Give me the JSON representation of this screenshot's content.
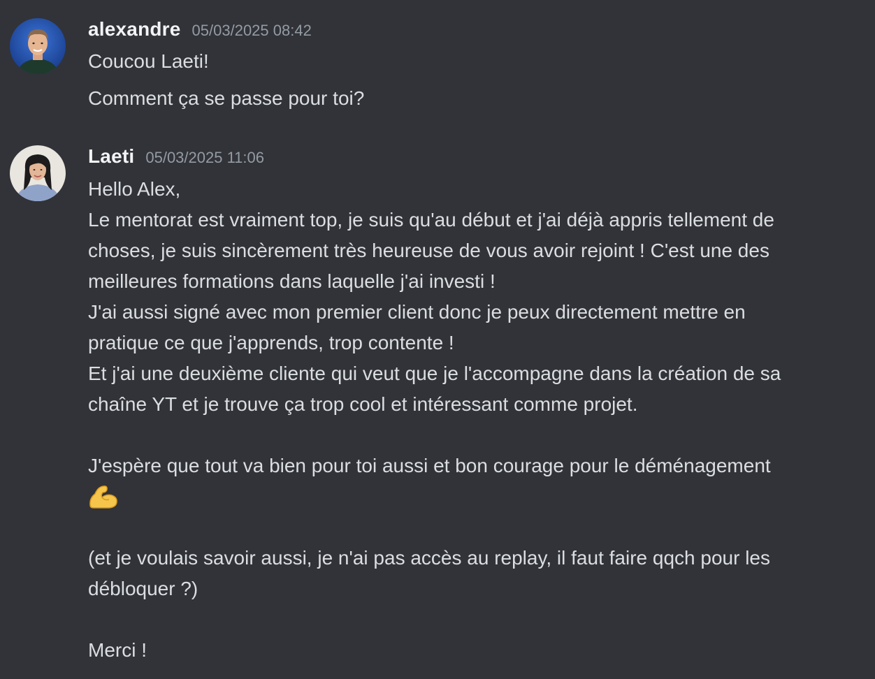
{
  "messages": [
    {
      "author": "alexandre",
      "timestamp": "05/03/2025 08:42",
      "lines": [
        "Coucou Laeti!"
      ],
      "second_lines": [
        "Comment ça se passe pour toi?"
      ]
    },
    {
      "author": "Laeti",
      "timestamp": "05/03/2025 11:06",
      "lines": [
        "Hello Alex,",
        "Le mentorat est vraiment top, je suis qu'au début et j'ai déjà appris tellement de",
        "choses, je suis sincèrement très heureuse de vous avoir rejoint ! C'est une des",
        "meilleures formations dans laquelle j'ai investi !",
        "J'ai aussi signé avec mon premier client donc je peux directement mettre en",
        "pratique ce que j'apprends, trop contente !",
        "Et j'ai une deuxième cliente qui veut que je l'accompagne dans la création de sa",
        "chaîne YT et je trouve ça trop cool et intéressant comme projet.",
        "",
        "J'espère que tout va bien pour toi aussi et bon courage pour le déménagement"
      ],
      "emoji": "flexed-biceps-emoji",
      "lines_after": [
        "",
        "(et je voulais savoir aussi, je n'ai pas accès au replay, il faut faire qqch pour les",
        "débloquer ?)",
        "",
        "Merci !"
      ]
    }
  ],
  "colors": {
    "background": "#313338",
    "text": "#dbdee1",
    "username": "#f2f3f5",
    "timestamp": "#949ba4"
  }
}
